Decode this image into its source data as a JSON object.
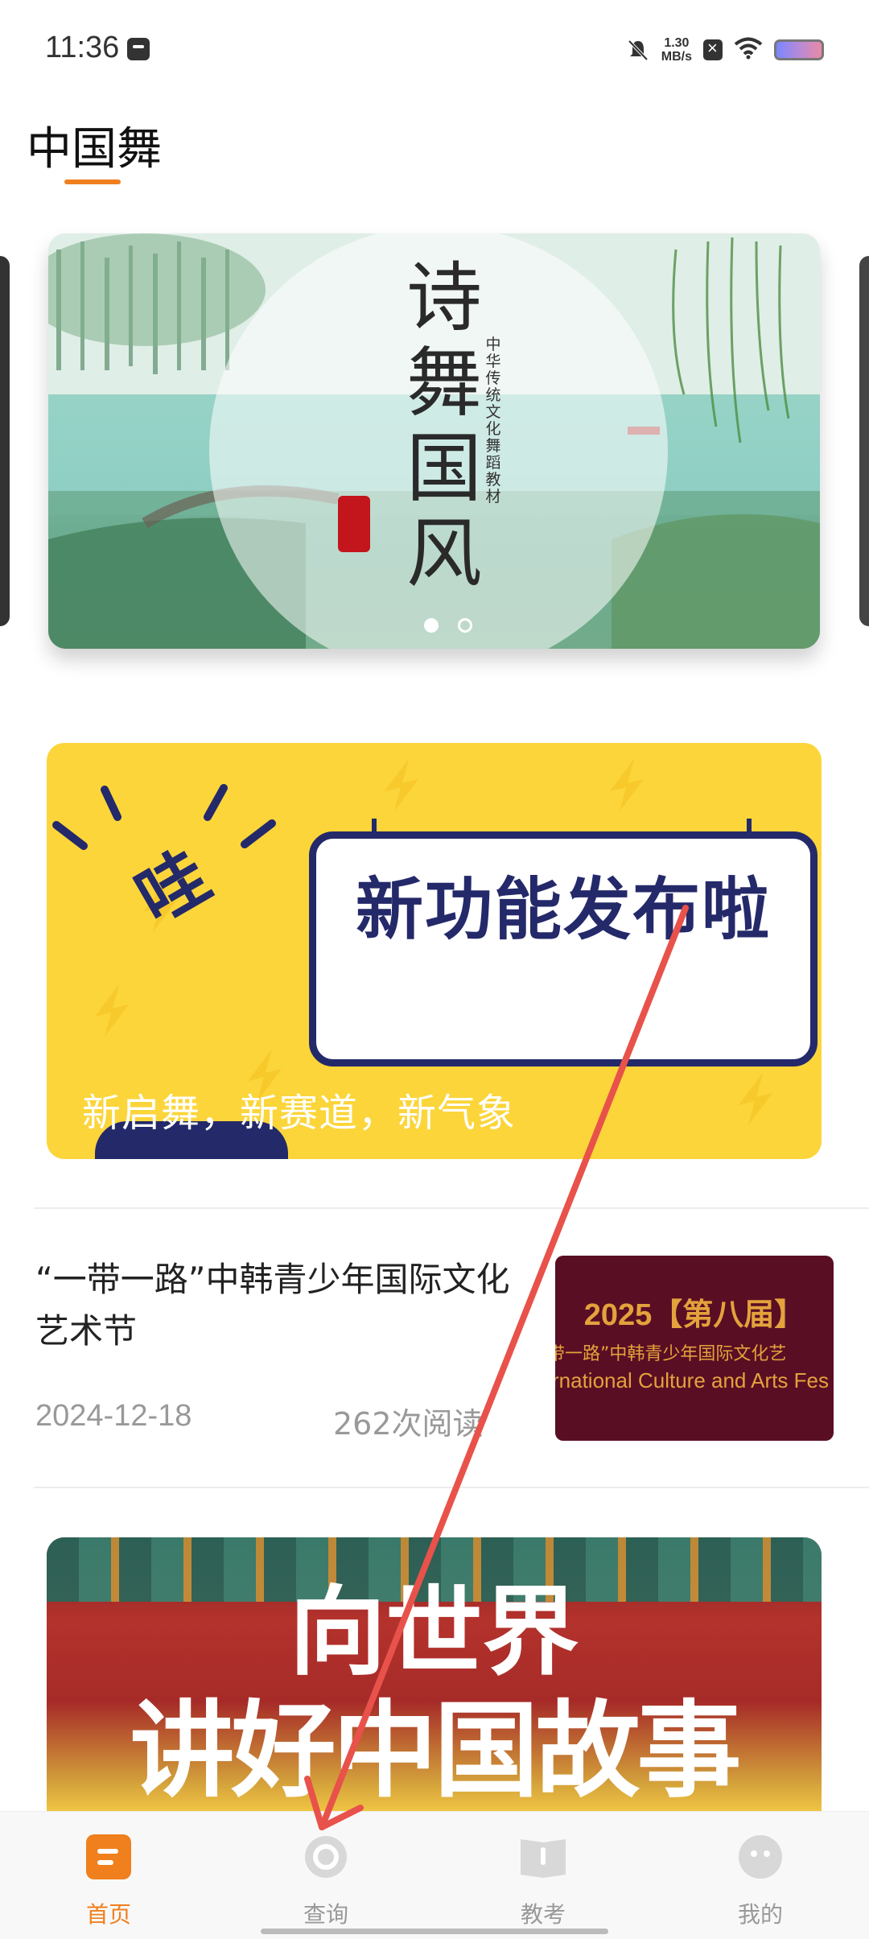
{
  "status_bar": {
    "time": "11:36",
    "net_speed_value": "1.30",
    "net_speed_unit": "MB/s",
    "icons": [
      "message-icon",
      "mute-bell-icon",
      "x-box-icon",
      "wifi-icon",
      "battery-icon"
    ]
  },
  "header": {
    "title": "中国舞"
  },
  "carousel": {
    "title": "诗舞国风",
    "subtitle": "中华传统文化舞蹈教材",
    "dot_count": 2,
    "active_index": 0
  },
  "promo": {
    "wa": "哇",
    "headline": "新功能发布啦",
    "caption": "新启舞，新赛道，新气象"
  },
  "news": {
    "title": "“一带一路”中韩青少年国际文化艺术节",
    "date": "2024-12-18",
    "views": "262次阅读",
    "thumb_line1": "2025【第八届】",
    "thumb_line2": "带一路”中韩青少年国际文化艺",
    "thumb_line3": "rnational Culture and Arts Fes"
  },
  "story_banner": {
    "line1": "向世界",
    "line2": "讲好中国故事"
  },
  "bottom_nav": {
    "items": [
      {
        "label": "首页",
        "icon": "home-icon",
        "active": true
      },
      {
        "label": "查询",
        "icon": "search-icon",
        "active": false
      },
      {
        "label": "教考",
        "icon": "book-icon",
        "active": false
      },
      {
        "label": "我的",
        "icon": "profile-icon",
        "active": false
      }
    ]
  },
  "colors": {
    "accent": "#f07f1d",
    "promo_yellow": "#fbd53a",
    "promo_navy": "#24296a",
    "annotation_arrow": "#e8524a"
  }
}
